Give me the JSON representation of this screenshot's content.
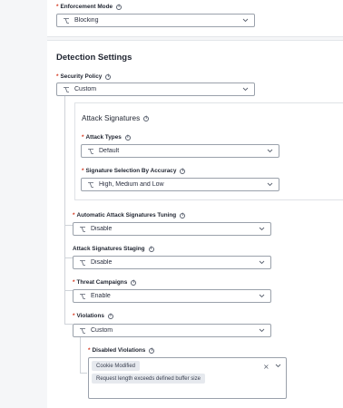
{
  "enforcement": {
    "label": "Enforcement Mode",
    "value": "Blocking"
  },
  "detection": {
    "title": "Detection Settings",
    "security_policy": {
      "label": "Security Policy",
      "value": "Custom"
    },
    "attack_signatures": {
      "title": "Attack Signatures",
      "attack_types": {
        "label": "Attack Types",
        "value": "Default"
      },
      "accuracy": {
        "label": "Signature Selection By Accuracy",
        "value": "High, Medium and Low"
      }
    },
    "auto_tuning": {
      "label": "Automatic Attack Signatures Tuning",
      "value": "Disable"
    },
    "staging": {
      "label": "Attack Signatures Staging",
      "value": "Disable"
    },
    "threat_campaigns": {
      "label": "Threat Campaigns",
      "value": "Enable"
    },
    "violations": {
      "label": "Violations",
      "value": "Custom"
    },
    "disabled_violations": {
      "label": "Disabled Violations",
      "tags": [
        "Cookie Modified",
        "Request length exceeds defined buffer size"
      ],
      "clear_symbol": "×"
    }
  },
  "colors": {
    "required": "#d4351c",
    "border": "#9aa1ab",
    "text": "#1f2430"
  },
  "icons": {
    "field_icon": "fork-icon",
    "dropdown": "chevron-down-icon",
    "help": "info-icon"
  }
}
